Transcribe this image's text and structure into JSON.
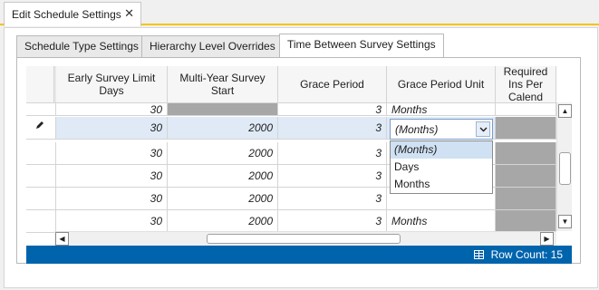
{
  "document_tab": {
    "title": "Edit Schedule Settings",
    "close_glyph": "✕"
  },
  "inner_tabs": [
    {
      "label": "Schedule Type Settings"
    },
    {
      "label": "Hierarchy Level Overrides"
    },
    {
      "label": "Time Between Survey Settings"
    }
  ],
  "grid": {
    "headers": {
      "early": "Early Survey Limit Days",
      "multiyear": "Multi-Year Survey Start",
      "grace": "Grace Period",
      "unit": "Grace Period Unit",
      "required": "Required Ins Per Calend"
    },
    "rows": [
      {
        "early": "30",
        "multiyear": "",
        "grace": "3",
        "unit": "Months"
      },
      {
        "early": "30",
        "multiyear": "2000",
        "grace": "3",
        "unit": "(Months)"
      },
      {
        "early": "30",
        "multiyear": "2000",
        "grace": "3",
        "unit": ""
      },
      {
        "early": "30",
        "multiyear": "2000",
        "grace": "3",
        "unit": ""
      },
      {
        "early": "30",
        "multiyear": "2000",
        "grace": "3",
        "unit": ""
      },
      {
        "early": "30",
        "multiyear": "2000",
        "grace": "3",
        "unit": "Months"
      }
    ],
    "edit_indicator_icon": "pencil-icon",
    "dropdown": {
      "value": "(Months)",
      "options": [
        "(Months)",
        "Days",
        "Months"
      ]
    },
    "row_count_label": "Row Count:",
    "row_count": "15"
  },
  "colors": {
    "accent": "#f5c400",
    "status_bar": "#0064ad",
    "selection": "#dfeaf6"
  }
}
